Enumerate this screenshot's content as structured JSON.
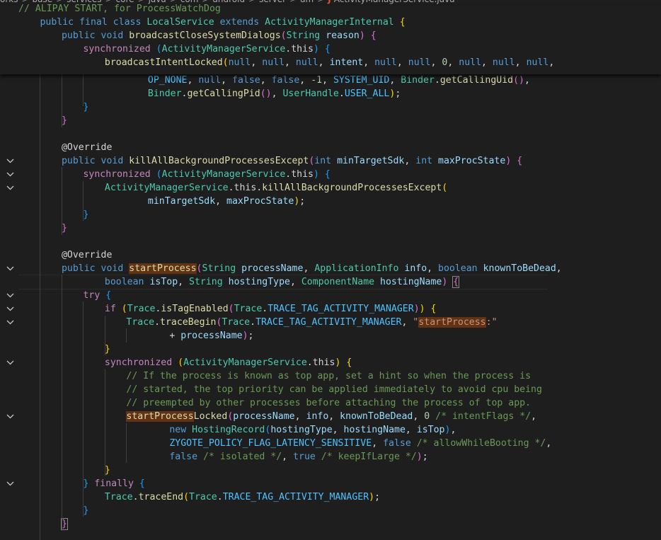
{
  "breadcrumb": {
    "segments": [
      "orks",
      "base",
      "services",
      "core",
      "java",
      "com",
      "android",
      "server",
      "am"
    ],
    "file_icon": "J",
    "file_name": "ActivityManagerService.java"
  },
  "sticky_lines": [
    [
      [
        "c",
        "// ALIPAY START, for ProcessWatchDog"
      ]
    ],
    [
      [
        "k",
        "public"
      ],
      [
        "",
        "␣"
      ],
      [
        "k",
        "final"
      ],
      [
        "",
        "␣"
      ],
      [
        "k",
        "class"
      ],
      [
        "",
        "␣"
      ],
      [
        "t",
        "LocalService"
      ],
      [
        "",
        "␣"
      ],
      [
        "k",
        "extends"
      ],
      [
        "",
        "␣"
      ],
      [
        "t",
        "ActivityManagerInternal"
      ],
      [
        "",
        "␣"
      ],
      [
        "p1",
        "{"
      ]
    ],
    [
      [
        "k",
        "public"
      ],
      [
        "",
        "␣"
      ],
      [
        "k",
        "void"
      ],
      [
        "",
        "␣"
      ],
      [
        "f",
        "broadcastCloseSystemDialogs"
      ],
      [
        "p2",
        "("
      ],
      [
        "t",
        "String"
      ],
      [
        "",
        "␣"
      ],
      [
        "v",
        "reason"
      ],
      [
        "p2",
        ")"
      ],
      [
        "",
        "␣"
      ],
      [
        "p2",
        "{"
      ]
    ],
    [
      [
        "kc",
        "synchronized"
      ],
      [
        "",
        "␣"
      ],
      [
        "p3",
        "("
      ],
      [
        "t",
        "ActivityManagerService"
      ],
      [
        "",
        ".this"
      ],
      [
        "p3",
        ")"
      ],
      [
        "",
        "␣"
      ],
      [
        "p3",
        "{"
      ]
    ],
    [
      [
        "f",
        "broadcastIntentLocked"
      ],
      [
        "p1",
        "("
      ],
      [
        "k",
        "null"
      ],
      [
        "",
        ", "
      ],
      [
        "k",
        "null"
      ],
      [
        "",
        ", "
      ],
      [
        "k",
        "null"
      ],
      [
        "",
        ", "
      ],
      [
        "v",
        "intent"
      ],
      [
        "",
        ", "
      ],
      [
        "k",
        "null"
      ],
      [
        "",
        ", "
      ],
      [
        "k",
        "null"
      ],
      [
        "",
        ", "
      ],
      [
        "n",
        "0"
      ],
      [
        "",
        ", "
      ],
      [
        "k",
        "null"
      ],
      [
        "",
        ", "
      ],
      [
        "k",
        "null"
      ],
      [
        "",
        ", "
      ],
      [
        "k",
        "null"
      ],
      [
        "",
        ","
      ]
    ]
  ],
  "code_lines": [
    [
      [
        "cst",
        "OP_NONE"
      ],
      [
        "",
        ", "
      ],
      [
        "k",
        "null"
      ],
      [
        "",
        ", "
      ],
      [
        "k",
        "false"
      ],
      [
        "",
        ", "
      ],
      [
        "k",
        "false"
      ],
      [
        "",
        ", "
      ],
      [
        "n",
        "-1"
      ],
      [
        "",
        ", "
      ],
      [
        "cst",
        "SYSTEM_UID"
      ],
      [
        "",
        ", "
      ],
      [
        "t",
        "Binder"
      ],
      [
        "",
        "."
      ],
      [
        "f",
        "getCallingUid"
      ],
      [
        "p2",
        "()"
      ],
      [
        "",
        ","
      ]
    ],
    [
      [
        "t",
        "Binder"
      ],
      [
        "",
        "."
      ],
      [
        "f",
        "getCallingPid"
      ],
      [
        "p2",
        "()"
      ],
      [
        "",
        ", "
      ],
      [
        "t",
        "UserHandle"
      ],
      [
        "",
        "."
      ],
      [
        "cst",
        "USER_ALL"
      ],
      [
        "p1",
        ")"
      ],
      [
        "",
        ";"
      ]
    ],
    [
      [
        "p3",
        "}"
      ]
    ],
    [
      [
        "p2",
        "}"
      ]
    ],
    [],
    [
      [
        "ann",
        "@Override"
      ]
    ],
    [
      [
        "k",
        "public"
      ],
      [
        "",
        "␣"
      ],
      [
        "k",
        "void"
      ],
      [
        "",
        "␣"
      ],
      [
        "f",
        "killAllBackgroundProcessesExcept"
      ],
      [
        "p2",
        "("
      ],
      [
        "k",
        "int"
      ],
      [
        "",
        "␣"
      ],
      [
        "v",
        "minTargetSdk"
      ],
      [
        "",
        ", "
      ],
      [
        "k",
        "int"
      ],
      [
        "",
        "␣"
      ],
      [
        "v",
        "maxProcState"
      ],
      [
        "p2",
        ")"
      ],
      [
        "",
        "␣"
      ],
      [
        "p2",
        "{"
      ]
    ],
    [
      [
        "kc",
        "synchronized"
      ],
      [
        "",
        "␣"
      ],
      [
        "p3",
        "("
      ],
      [
        "t",
        "ActivityManagerService"
      ],
      [
        "",
        ".this"
      ],
      [
        "p3",
        ")"
      ],
      [
        "",
        "␣"
      ],
      [
        "p3",
        "{"
      ]
    ],
    [
      [
        "t",
        "ActivityManagerService"
      ],
      [
        "",
        ".this."
      ],
      [
        "f",
        "killAllBackgroundProcessesExcept"
      ],
      [
        "p1",
        "("
      ]
    ],
    [
      [
        "v",
        "minTargetSdk"
      ],
      [
        "",
        ", "
      ],
      [
        "v",
        "maxProcState"
      ],
      [
        "p1",
        ")"
      ],
      [
        "",
        ";"
      ]
    ],
    [
      [
        "p3",
        "}"
      ]
    ],
    [
      [
        "p2",
        "}"
      ]
    ],
    [],
    [
      [
        "ann",
        "@Override"
      ]
    ],
    [
      [
        "k",
        "public"
      ],
      [
        "",
        "␣"
      ],
      [
        "k",
        "void"
      ],
      [
        "",
        "␣"
      ],
      [
        "fh",
        "startProcess"
      ],
      [
        "p2",
        "("
      ],
      [
        "t",
        "String"
      ],
      [
        "",
        "␣"
      ],
      [
        "v",
        "processName"
      ],
      [
        "",
        ", "
      ],
      [
        "t",
        "ApplicationInfo"
      ],
      [
        "",
        "␣"
      ],
      [
        "v",
        "info"
      ],
      [
        "",
        ", "
      ],
      [
        "k",
        "boolean"
      ],
      [
        "",
        "␣"
      ],
      [
        "v",
        "knownToBeDead"
      ],
      [
        "",
        ","
      ]
    ],
    [
      [
        "k",
        "boolean"
      ],
      [
        "",
        "␣"
      ],
      [
        "v",
        "isTop"
      ],
      [
        "",
        ", "
      ],
      [
        "t",
        "String"
      ],
      [
        "",
        "␣"
      ],
      [
        "v",
        "hostingType"
      ],
      [
        "",
        ", "
      ],
      [
        "t",
        "ComponentName"
      ],
      [
        "",
        "␣"
      ],
      [
        "v",
        "hostingName"
      ],
      [
        "p2",
        ")"
      ],
      [
        "",
        "␣"
      ],
      [
        "bm",
        "{"
      ]
    ],
    [
      [
        "kc",
        "try"
      ],
      [
        "",
        "␣"
      ],
      [
        "p3",
        "{"
      ]
    ],
    [
      [
        "kc",
        "if"
      ],
      [
        "",
        "␣"
      ],
      [
        "p1",
        "("
      ],
      [
        "t",
        "Trace"
      ],
      [
        "",
        "."
      ],
      [
        "f",
        "isTagEnabled"
      ],
      [
        "p2",
        "("
      ],
      [
        "t",
        "Trace"
      ],
      [
        "",
        "."
      ],
      [
        "cst",
        "TRACE_TAG_ACTIVITY_MANAGER"
      ],
      [
        "p2",
        ")"
      ],
      [
        "p1",
        ")"
      ],
      [
        "",
        "␣"
      ],
      [
        "p1",
        "{"
      ]
    ],
    [
      [
        "t",
        "Trace"
      ],
      [
        "",
        "."
      ],
      [
        "f",
        "traceBegin"
      ],
      [
        "p2",
        "("
      ],
      [
        "t",
        "Trace"
      ],
      [
        "",
        "."
      ],
      [
        "cst",
        "TRACE_TAG_ACTIVITY_MANAGER"
      ],
      [
        "",
        ", "
      ],
      [
        "s",
        "\""
      ],
      [
        "sh",
        "startProcess"
      ],
      [
        "s",
        ":\""
      ]
    ],
    [
      [
        "",
        "+ "
      ],
      [
        "v",
        "processName"
      ],
      [
        "p2",
        ")"
      ],
      [
        "",
        ";"
      ]
    ],
    [
      [
        "p1",
        "}"
      ]
    ],
    [
      [
        "kc",
        "synchronized"
      ],
      [
        "",
        "␣"
      ],
      [
        "p1",
        "("
      ],
      [
        "t",
        "ActivityManagerService"
      ],
      [
        "",
        ".this"
      ],
      [
        "p1",
        ")"
      ],
      [
        "",
        "␣"
      ],
      [
        "p1",
        "{"
      ]
    ],
    [
      [
        "c",
        "// If the process is known as top app, set a hint so when the process is"
      ]
    ],
    [
      [
        "c",
        "// started, the top priority can be applied immediately to avoid cpu being"
      ]
    ],
    [
      [
        "c",
        "// preempted by other processes before attaching the process of top app."
      ]
    ],
    [
      [
        "fh",
        "startProcess"
      ],
      [
        "f",
        "Locked"
      ],
      [
        "p2",
        "("
      ],
      [
        "v",
        "processName"
      ],
      [
        "",
        ", "
      ],
      [
        "v",
        "info"
      ],
      [
        "",
        ", "
      ],
      [
        "v",
        "knownToBeDead"
      ],
      [
        "",
        ", "
      ],
      [
        "n",
        "0"
      ],
      [
        "",
        "␣"
      ],
      [
        "c",
        "/* intentFlags */"
      ],
      [
        "",
        ","
      ]
    ],
    [
      [
        "k",
        "new"
      ],
      [
        "",
        "␣"
      ],
      [
        "t",
        "HostingRecord"
      ],
      [
        "p3",
        "("
      ],
      [
        "v",
        "hostingType"
      ],
      [
        "",
        ", "
      ],
      [
        "v",
        "hostingName"
      ],
      [
        "",
        ", "
      ],
      [
        "v",
        "isTop"
      ],
      [
        "p3",
        ")"
      ],
      [
        "",
        ","
      ]
    ],
    [
      [
        "cst",
        "ZYGOTE_POLICY_FLAG_LATENCY_SENSITIVE"
      ],
      [
        "",
        ", "
      ],
      [
        "k",
        "false"
      ],
      [
        "",
        "␣"
      ],
      [
        "c",
        "/* allowWhileBooting */"
      ],
      [
        "",
        ","
      ]
    ],
    [
      [
        "k",
        "false"
      ],
      [
        "",
        "␣"
      ],
      [
        "c",
        "/* isolated */"
      ],
      [
        "",
        ", "
      ],
      [
        "k",
        "true"
      ],
      [
        "",
        "␣"
      ],
      [
        "c",
        "/* keepIfLarge */"
      ],
      [
        "p2",
        ")"
      ],
      [
        "",
        ";"
      ]
    ],
    [
      [
        "p1",
        "}"
      ]
    ],
    [
      [
        "p3",
        "}"
      ],
      [
        "",
        "␣"
      ],
      [
        "kc",
        "finally"
      ],
      [
        "",
        "␣"
      ],
      [
        "p3",
        "{"
      ]
    ],
    [
      [
        "t",
        "Trace"
      ],
      [
        "",
        "."
      ],
      [
        "f",
        "traceEnd"
      ],
      [
        "p1",
        "("
      ],
      [
        "t",
        "Trace"
      ],
      [
        "",
        "."
      ],
      [
        "cst",
        "TRACE_TAG_ACTIVITY_MANAGER"
      ],
      [
        "p1",
        ")"
      ],
      [
        "",
        ";"
      ]
    ],
    [
      [
        "p3",
        "}"
      ]
    ],
    [
      [
        "bm",
        "}"
      ]
    ]
  ]
}
